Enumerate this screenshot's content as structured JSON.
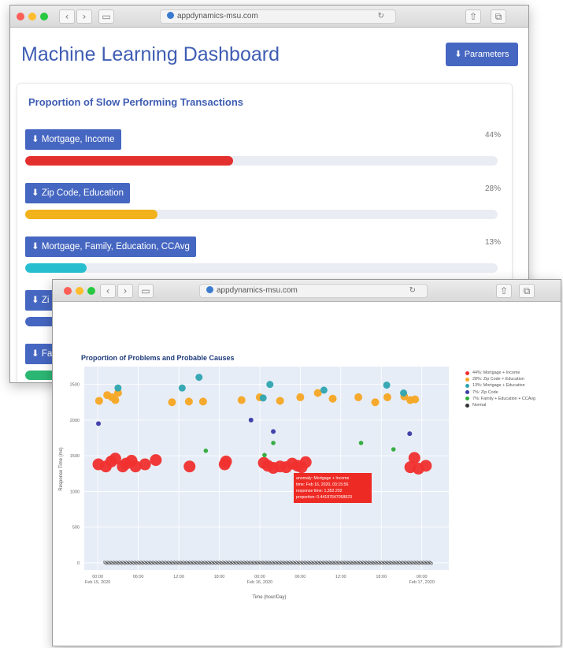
{
  "window1": {
    "url": "appdynamics-msu.com",
    "title": "Machine Learning Dashboard",
    "parameters_button": "⬇ Parameters",
    "card_title": "Proportion of Slow Performing Transactions",
    "items": [
      {
        "label": "⬇ Mortgage, Income",
        "percent": "44%",
        "fill": 0.44,
        "color": "#e3302f"
      },
      {
        "label": "⬇ Zip Code, Education",
        "percent": "28%",
        "fill": 0.28,
        "color": "#f2b21b"
      },
      {
        "label": "⬇ Mortgage, Family, Education, CCAvg",
        "percent": "13%",
        "fill": 0.13,
        "color": "#27bfd0"
      },
      {
        "label": "⬇ Zi",
        "percent": "",
        "fill": 0.07,
        "color": "#4667c1"
      },
      {
        "label": "⬇ Fa",
        "percent": "",
        "fill": 0.07,
        "color": "#2bb673"
      }
    ]
  },
  "window2": {
    "url": "appdynamics-msu.com",
    "chart_title": "Proportion of Problems and Probable Causes",
    "legend": [
      {
        "label": "44%: Mortgage + Income",
        "color": "#f0302e"
      },
      {
        "label": "28%: Zip Code + Education",
        "color": "#f5a623"
      },
      {
        "label": "13%: Mortgage + Education",
        "color": "#2ea5b0"
      },
      {
        "label": "7%: Zip Code",
        "color": "#3a3aa6"
      },
      {
        "label": "7%: Family + Education + CCAvg",
        "color": "#2eaa3a"
      },
      {
        "label": "Normal",
        "color": "#333333"
      }
    ],
    "tooltip": [
      "anomaly: Mortgage + Income",
      "time: Feb 16, 2020, 03:15:56",
      "response time: 1,352.202",
      "proportion: 0.44197647058823"
    ]
  },
  "chart_data": {
    "type": "scatter",
    "title": "Proportion of Problems and Probable Causes",
    "xlabel": "Time (hour/Day)",
    "ylabel": "Response Time (ms)",
    "ylim": [
      -100,
      2750
    ],
    "xlim": [
      -2,
      52
    ],
    "yticks": [
      0,
      500,
      1000,
      1500,
      2000,
      2500
    ],
    "xticks": [
      {
        "x": 0,
        "l1": "00:00",
        "l2": "Feb 15, 2020"
      },
      {
        "x": 6,
        "l1": "06:00",
        "l2": ""
      },
      {
        "x": 12,
        "l1": "12:00",
        "l2": ""
      },
      {
        "x": 18,
        "l1": "18:00",
        "l2": ""
      },
      {
        "x": 24,
        "l1": "00:00",
        "l2": "Feb 16, 2020"
      },
      {
        "x": 30,
        "l1": "06:00",
        "l2": ""
      },
      {
        "x": 36,
        "l1": "12:00",
        "l2": ""
      },
      {
        "x": 42,
        "l1": "18:00",
        "l2": ""
      },
      {
        "x": 48,
        "l1": "00:00",
        "l2": "Feb 17, 2020"
      }
    ],
    "series": [
      {
        "name": "44%: Mortgage + Income",
        "color": "#f0302e",
        "size": 7.5,
        "points": [
          [
            0.1,
            1380
          ],
          [
            1.2,
            1350
          ],
          [
            2,
            1420
          ],
          [
            2.6,
            1460
          ],
          [
            3.7,
            1350
          ],
          [
            4.2,
            1390
          ],
          [
            5,
            1430
          ],
          [
            5.6,
            1350
          ],
          [
            7,
            1380
          ],
          [
            8.6,
            1440
          ],
          [
            13.6,
            1350
          ],
          [
            18.8,
            1380
          ],
          [
            19,
            1420
          ],
          [
            24.6,
            1400
          ],
          [
            25.2,
            1360
          ],
          [
            26,
            1330
          ],
          [
            27,
            1350
          ],
          [
            27.9,
            1340
          ],
          [
            28.8,
            1390
          ],
          [
            29.6,
            1360
          ],
          [
            30.2,
            1340
          ],
          [
            30.8,
            1410
          ],
          [
            46.3,
            1340
          ],
          [
            46.9,
            1470
          ],
          [
            47.5,
            1320
          ],
          [
            48.6,
            1360
          ]
        ]
      },
      {
        "name": "28%: Zip Code + Education",
        "color": "#f5a623",
        "size": 5,
        "points": [
          [
            0.2,
            2270
          ],
          [
            1.4,
            2350
          ],
          [
            2.1,
            2320
          ],
          [
            2.6,
            2280
          ],
          [
            3,
            2380
          ],
          [
            11,
            2250
          ],
          [
            13.5,
            2260
          ],
          [
            15.6,
            2260
          ],
          [
            21.3,
            2280
          ],
          [
            24,
            2320
          ],
          [
            27,
            2270
          ],
          [
            30,
            2320
          ],
          [
            32.6,
            2380
          ],
          [
            34.8,
            2300
          ],
          [
            38.6,
            2320
          ],
          [
            41.1,
            2250
          ],
          [
            42.9,
            2320
          ],
          [
            45.4,
            2330
          ],
          [
            46.3,
            2280
          ],
          [
            47,
            2290
          ]
        ]
      },
      {
        "name": "13%: Mortgage + Education",
        "color": "#2ea5b0",
        "size": 4.5,
        "points": [
          [
            3,
            2450
          ],
          [
            12.5,
            2450
          ],
          [
            15,
            2600
          ],
          [
            24.5,
            2310
          ],
          [
            25.5,
            2500
          ],
          [
            33.5,
            2420
          ],
          [
            42.8,
            2490
          ],
          [
            45.3,
            2380
          ]
        ]
      },
      {
        "name": "7%: Zip Code",
        "color": "#3a3aa6",
        "size": 3,
        "points": [
          [
            0.1,
            1950
          ],
          [
            22.7,
            2000
          ],
          [
            26,
            1840
          ],
          [
            46.2,
            1810
          ]
        ]
      },
      {
        "name": "7%: Family + Education + CCAvg",
        "color": "#2eaa3a",
        "size": 2.8,
        "points": [
          [
            16,
            1570
          ],
          [
            24.7,
            1510
          ],
          [
            26,
            1680
          ],
          [
            39,
            1680
          ],
          [
            43.8,
            1590
          ]
        ]
      }
    ]
  }
}
